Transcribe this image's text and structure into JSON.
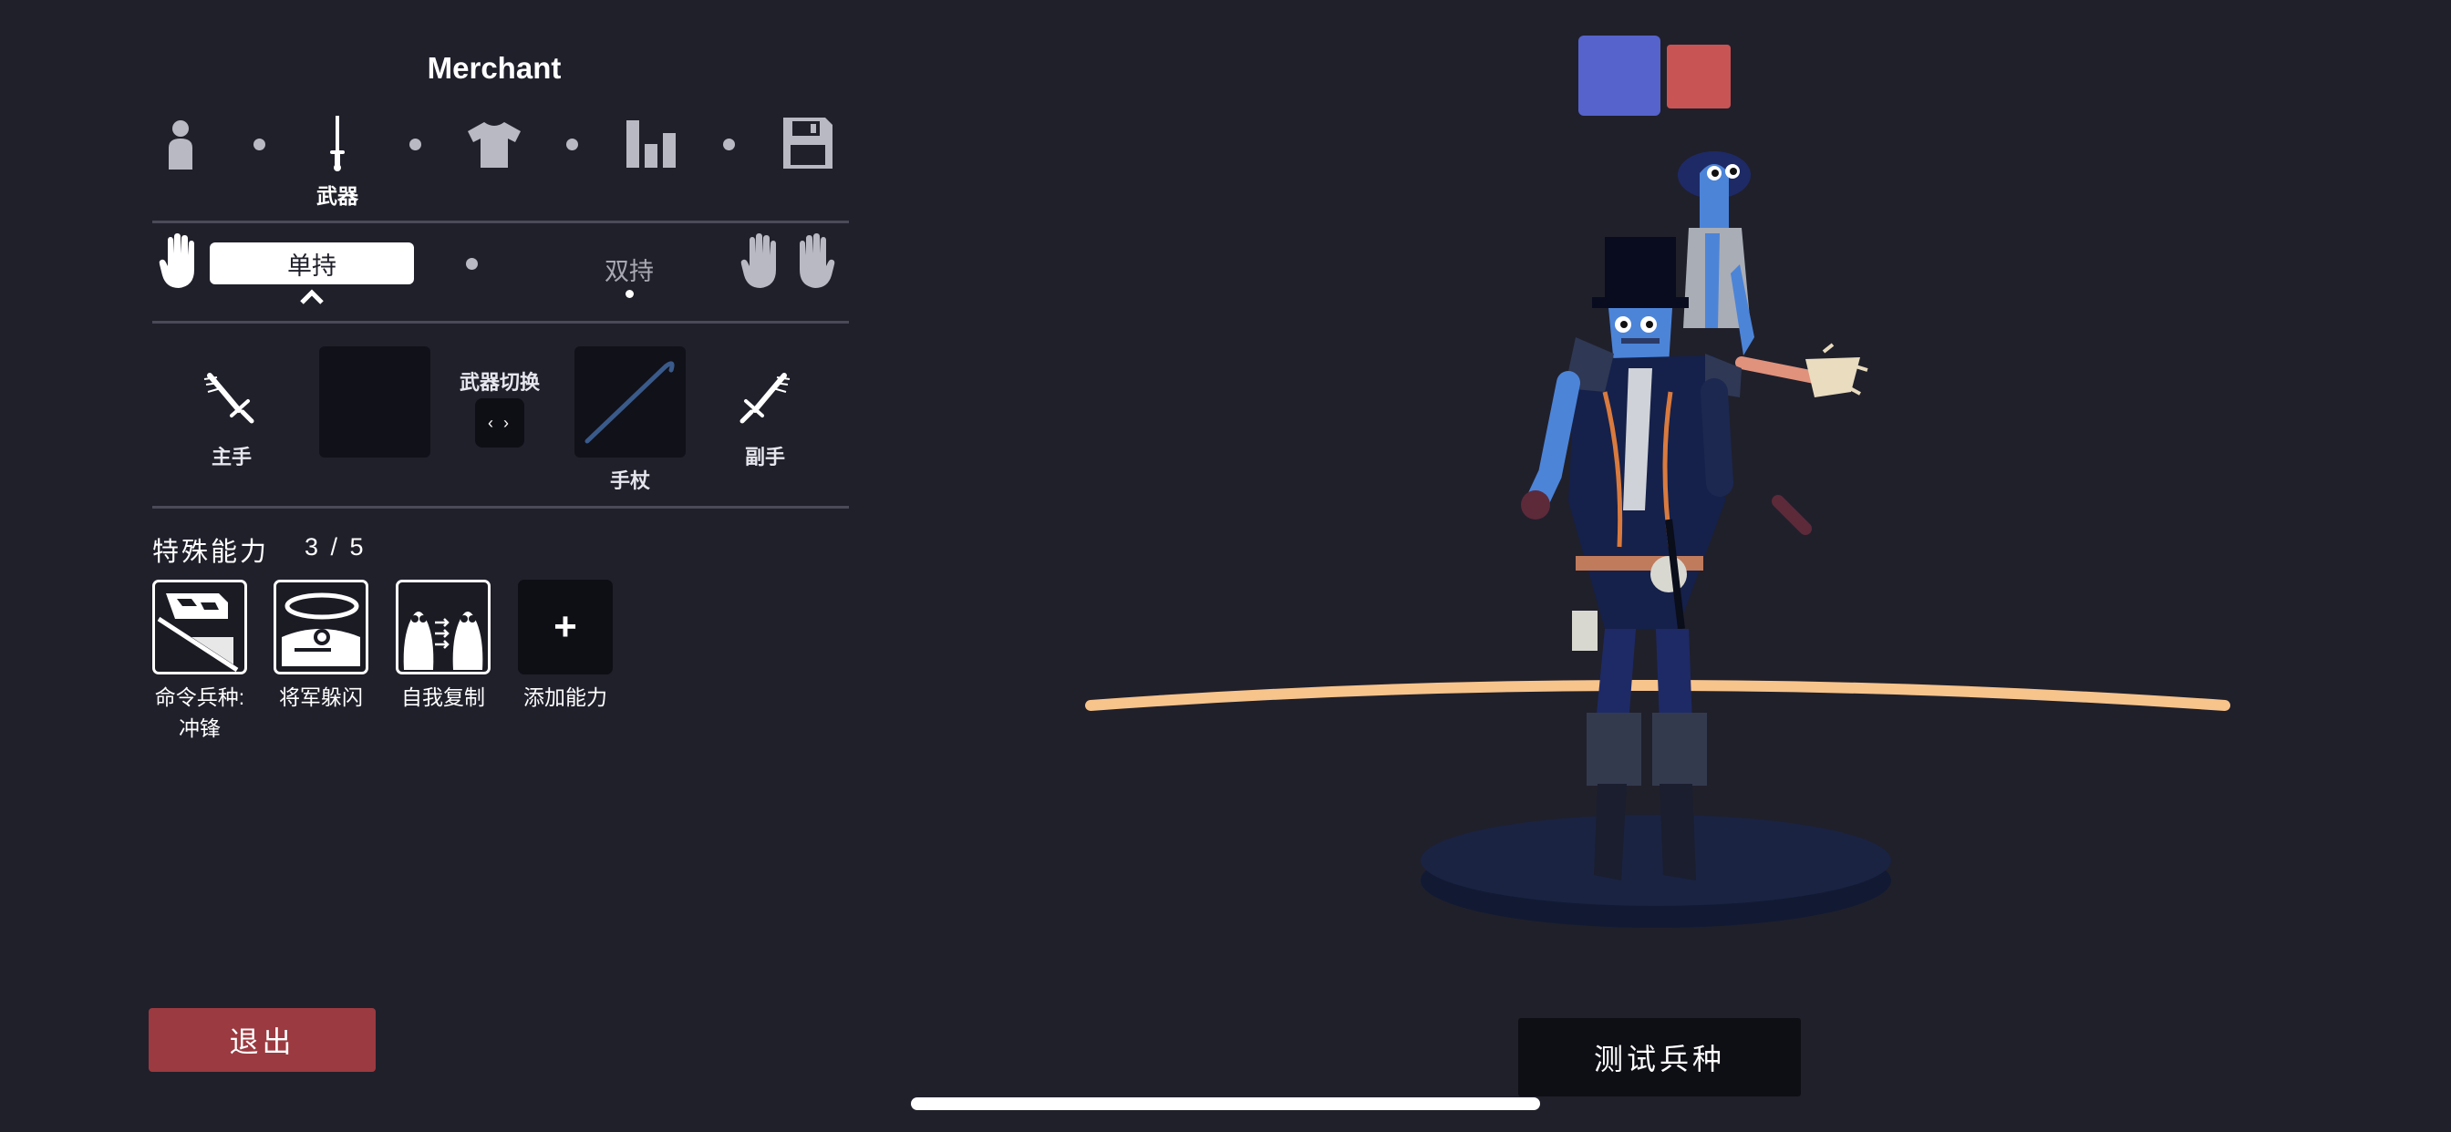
{
  "unit": {
    "name": "Merchant"
  },
  "steps": {
    "items": [
      {
        "icon": "person-icon",
        "label": ""
      },
      {
        "icon": "sword-icon",
        "label": "武器",
        "active": true
      },
      {
        "icon": "shirt-icon",
        "label": ""
      },
      {
        "icon": "stats-icon",
        "label": ""
      },
      {
        "icon": "save-icon",
        "label": ""
      }
    ]
  },
  "hands": {
    "one_handed": "单持",
    "two_handed": "双持",
    "selected": "one_handed"
  },
  "weapons": {
    "main_hand_label": "主手",
    "switch_label": "武器切换",
    "switch_button": "‹ ›",
    "offhand_weapon_name": "手杖",
    "off_hand_label": "副手"
  },
  "abilities": {
    "title": "特殊能力",
    "count": "3 / 5",
    "items": [
      {
        "icon": "command-charge-icon",
        "label_line1": "命令兵种:",
        "label_line2": "冲锋"
      },
      {
        "icon": "general-dodge-icon",
        "label_line1": "将军躲闪",
        "label_line2": ""
      },
      {
        "icon": "self-clone-icon",
        "label_line1": "自我复制",
        "label_line2": ""
      }
    ],
    "add_symbol": "+",
    "add_label": "添加能力"
  },
  "buttons": {
    "exit": "退出",
    "test_unit": "测试兵种"
  },
  "colors": {
    "background": "#20202b",
    "team_blue": "#5663cc",
    "team_red": "#c95454",
    "exit_button": "#9b3a40",
    "ground_line": "#f7c48c",
    "pedestal": "#1a2342"
  }
}
